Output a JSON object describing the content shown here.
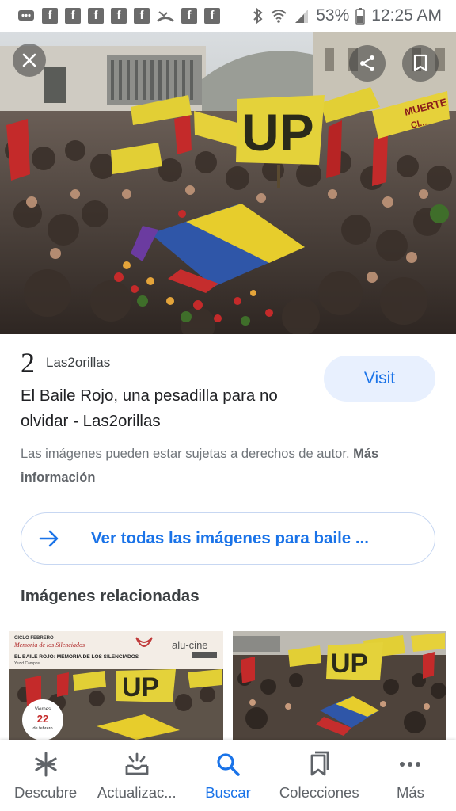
{
  "status_bar": {
    "battery": "53%",
    "time": "12:25 AM",
    "notification_icons": [
      "chat-icon",
      "facebook-icon",
      "facebook-icon",
      "facebook-icon",
      "facebook-icon",
      "facebook-icon",
      "missed-call-icon",
      "facebook-icon",
      "facebook-icon"
    ],
    "fb_glyph": "f"
  },
  "hero": {
    "sign_text": "UP",
    "banner_text": "MUERTE",
    "banner_text_2": "CI..."
  },
  "result": {
    "source_logo": "2",
    "source_name": "Las2orillas",
    "visit_label": "Visit",
    "title": "El Baile Rojo, una pesadilla para no olvidar - Las2orillas",
    "copyright_text": "Las imágenes pueden estar sujetas a derechos de autor.",
    "more_info_label": "Más información"
  },
  "see_all": {
    "label": "Ver todas las imágenes para baile ..."
  },
  "related": {
    "title": "Imágenes relacionadas",
    "thumb1": {
      "header": "CICLO FEBRERO",
      "subheader": "Memoria de los Silenciados",
      "brand": "alu-cine",
      "headline": "EL BAILE ROJO: MEMORIA DE LOS SILENCIADOS",
      "author": "Yezid Campos",
      "date_day": "Viernes",
      "date_num": "22",
      "date_month": "de febrero",
      "sign_text": "UP"
    },
    "thumb2": {
      "sign_text": "UP"
    }
  },
  "bottom_nav": [
    {
      "label": "Descubre",
      "icon": "asterisk-icon",
      "active": false
    },
    {
      "label": "Actualizac...",
      "icon": "updates-icon",
      "active": false
    },
    {
      "label": "Buscar",
      "icon": "search-icon",
      "active": true
    },
    {
      "label": "Colecciones",
      "icon": "collections-icon",
      "active": false
    },
    {
      "label": "Más",
      "icon": "more-icon",
      "active": false
    }
  ],
  "colors": {
    "accent": "#1a73e8",
    "visit_bg": "#e8f0fe",
    "muted_text": "#70757a"
  }
}
